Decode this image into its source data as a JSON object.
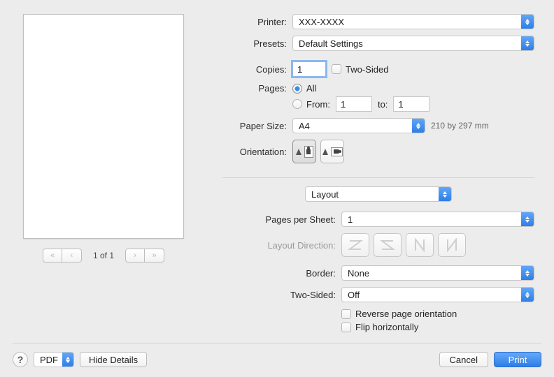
{
  "labels": {
    "printer": "Printer:",
    "presets": "Presets:",
    "copies": "Copies:",
    "two_sided_chk": "Two-Sided",
    "pages": "Pages:",
    "all": "All",
    "from": "From:",
    "to": "to:",
    "paper_size": "Paper Size:",
    "orientation": "Orientation:",
    "pages_per_sheet": "Pages per Sheet:",
    "layout_direction": "Layout Direction:",
    "border": "Border:",
    "two_sided": "Two-Sided:",
    "reverse": "Reverse page orientation",
    "flip": "Flip horizontally"
  },
  "values": {
    "printer": "XXX-XXXX",
    "presets": "Default Settings",
    "copies": "1",
    "from": "1",
    "to": "1",
    "paper_size": "A4",
    "paper_hint": "210 by 297 mm",
    "section": "Layout",
    "pages_per_sheet": "1",
    "border": "None",
    "two_sided": "Off"
  },
  "pager": {
    "label": "1 of 1"
  },
  "footer": {
    "help": "?",
    "pdf": "PDF",
    "hide_details": "Hide Details",
    "cancel": "Cancel",
    "print": "Print"
  }
}
